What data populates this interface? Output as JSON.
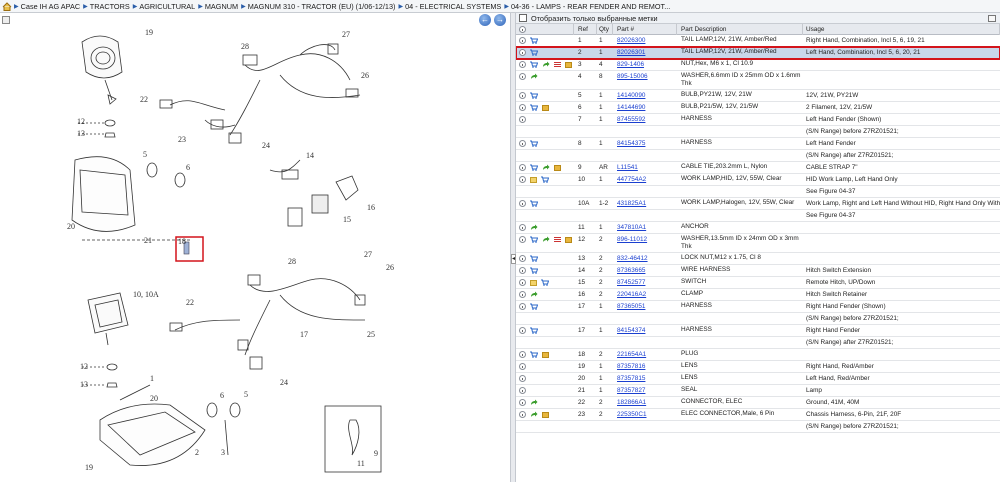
{
  "breadcrumb": [
    "Case IH AG APAC",
    "TRACTORS",
    "AGRICULTURAL",
    "MAGNUM",
    "MAGNUM 310 - TRACTOR (EU) (1/06-12/13)",
    "04 - ELECTRICAL SYSTEMS",
    "04-36 - LAMPS - REAR FENDER AND REMOT..."
  ],
  "filter_label": "Отобразить только выбранные метки",
  "columns": {
    "ref": "Ref",
    "qty": "Qty",
    "part": "Part #",
    "desc": "Part Description",
    "usage": "Usage"
  },
  "rows": [
    {
      "icons": [
        "info",
        "cart"
      ],
      "ref": "1",
      "qty": "1",
      "part": "82026300",
      "desc": "TAIL LAMP,12V, 21W, Amber/Red",
      "usage": "Right Hand, Combination, Incl 5, 6, 19, 21"
    },
    {
      "icons": [
        "info",
        "cart"
      ],
      "ref": "2",
      "qty": "1",
      "part": "82026301",
      "desc": "TAIL LAMP,12V, 21W, Amber/Red",
      "usage": "Left Hand, Combination, Incl 5, 6, 20, 21",
      "selected": true
    },
    {
      "icons": [
        "info",
        "cart",
        "arrow",
        "list",
        "box"
      ],
      "ref": "3",
      "qty": "4",
      "part": "829-1406",
      "desc": "NUT,Hex, M6 x 1, Cl 10.9",
      "usage": ""
    },
    {
      "icons": [
        "info",
        "arrow"
      ],
      "ref": "4",
      "qty": "8",
      "part": "895-15006",
      "desc": "WASHER,6.6mm ID x 25mm OD x 1.6mm Thk",
      "usage": ""
    },
    {
      "icons": [
        "info",
        "cart"
      ],
      "ref": "5",
      "qty": "1",
      "part": "14140090",
      "desc": "BULB,PY21W, 12V, 21W",
      "usage": "12V, 21W, PY21W"
    },
    {
      "icons": [
        "info",
        "cart",
        "box"
      ],
      "ref": "6",
      "qty": "1",
      "part": "14144690",
      "desc": "BULB,P21/5W, 12V, 21/5W",
      "usage": "2 Filament, 12V, 21/5W"
    },
    {
      "icons": [
        "info"
      ],
      "ref": "7",
      "qty": "1",
      "part": "87455592",
      "desc": "HARNESS",
      "usage": "Left Hand Fender (Shown)"
    },
    {
      "icons": [],
      "ref": "",
      "qty": "",
      "part": "",
      "desc": "",
      "usage": "(S/N Range) before Z7RZ01521;"
    },
    {
      "icons": [
        "info",
        "cart"
      ],
      "ref": "8",
      "qty": "1",
      "part": "84154375",
      "desc": "HARNESS",
      "usage": "Left Hand Fender"
    },
    {
      "icons": [],
      "ref": "",
      "qty": "",
      "part": "",
      "desc": "",
      "usage": "(S/N Range) after Z7RZ01521;"
    },
    {
      "icons": [
        "info",
        "cart",
        "arrow",
        "box"
      ],
      "ref": "9",
      "qty": "AR",
      "part": "L11541",
      "desc": "CABLE TIE,203.2mm L, Nylon",
      "usage": "CABLE STRAP 7\""
    },
    {
      "icons": [
        "info",
        "note",
        "cart"
      ],
      "ref": "10",
      "qty": "1",
      "part": "447754A2",
      "desc": "WORK LAMP,HID, 12V, 55W, Clear",
      "usage": "HID Work Lamp, Left Hand Only"
    },
    {
      "icons": [],
      "ref": "",
      "qty": "",
      "part": "",
      "desc": "",
      "usage": "See Figure 04-37"
    },
    {
      "icons": [
        "info",
        "cart"
      ],
      "ref": "10A",
      "qty": "1-2",
      "part": "431825A1",
      "desc": "WORK LAMP,Halogen, 12V, 55W, Clear",
      "usage": "Work Lamp, Right and Left Hand Without HID, Right Hand Only With HID"
    },
    {
      "icons": [],
      "ref": "",
      "qty": "",
      "part": "",
      "desc": "",
      "usage": "See Figure 04-37"
    },
    {
      "icons": [
        "info",
        "arrow"
      ],
      "ref": "11",
      "qty": "1",
      "part": "347810A1",
      "desc": "ANCHOR",
      "usage": ""
    },
    {
      "icons": [
        "info",
        "cart",
        "arrow",
        "list",
        "box"
      ],
      "ref": "12",
      "qty": "2",
      "part": "896-11012",
      "desc": "WASHER,13.5mm ID x 24mm OD x 3mm Thk",
      "usage": ""
    },
    {
      "icons": [
        "info",
        "cart"
      ],
      "ref": "13",
      "qty": "2",
      "part": "832-46412",
      "desc": "LOCK NUT,M12 x 1.75, Cl 8",
      "usage": ""
    },
    {
      "icons": [
        "info",
        "cart"
      ],
      "ref": "14",
      "qty": "2",
      "part": "87363665",
      "desc": "WIRE HARNESS",
      "usage": "Hitch Switch Extension"
    },
    {
      "icons": [
        "info",
        "note",
        "cart"
      ],
      "ref": "15",
      "qty": "2",
      "part": "87452577",
      "desc": "SWITCH",
      "usage": "Remote Hitch, UP/Down"
    },
    {
      "icons": [
        "info",
        "arrow"
      ],
      "ref": "16",
      "qty": "2",
      "part": "220416A2",
      "desc": "CLAMP",
      "usage": "Hitch Switch Retainer"
    },
    {
      "icons": [
        "info",
        "cart"
      ],
      "ref": "17",
      "qty": "1",
      "part": "87365051",
      "desc": "HARNESS",
      "usage": "Right Hand Fender (Shown)"
    },
    {
      "icons": [],
      "ref": "",
      "qty": "",
      "part": "",
      "desc": "",
      "usage": "(S/N Range) before Z7RZ01521;"
    },
    {
      "icons": [
        "info",
        "cart"
      ],
      "ref": "17",
      "qty": "1",
      "part": "84154374",
      "desc": "HARNESS",
      "usage": "Right Hand Fender"
    },
    {
      "icons": [],
      "ref": "",
      "qty": "",
      "part": "",
      "desc": "",
      "usage": "(S/N Range) after Z7RZ01521;"
    },
    {
      "icons": [
        "info",
        "cart",
        "box"
      ],
      "ref": "18",
      "qty": "2",
      "part": "221654A1",
      "desc": "PLUG",
      "usage": ""
    },
    {
      "icons": [
        "info"
      ],
      "ref": "19",
      "qty": "1",
      "part": "87357816",
      "desc": "LENS",
      "usage": "Right Hand, Red/Amber"
    },
    {
      "icons": [
        "info"
      ],
      "ref": "20",
      "qty": "1",
      "part": "87357815",
      "desc": "LENS",
      "usage": "Left Hand, Red/Amber"
    },
    {
      "icons": [
        "info"
      ],
      "ref": "21",
      "qty": "1",
      "part": "87357827",
      "desc": "SEAL",
      "usage": "Lamp"
    },
    {
      "icons": [
        "info",
        "arrow"
      ],
      "ref": "22",
      "qty": "2",
      "part": "182866A1",
      "desc": "CONNECTOR, ELEC",
      "usage": "Ground, 41M, 40M"
    },
    {
      "icons": [
        "info",
        "arrow",
        "box"
      ],
      "ref": "23",
      "qty": "2",
      "part": "225350C1",
      "desc": "ELEC CONNECTOR,Male, 6 Pin",
      "usage": "Chassis Harness, 6-Pin, 21F, 20F"
    },
    {
      "icons": [],
      "ref": "",
      "qty": "",
      "part": "",
      "desc": "",
      "usage": "(S/N Range) before Z7RZ01521;"
    }
  ],
  "diagram_labels": [
    "19",
    "28",
    "27",
    "26",
    "22",
    "12",
    "13",
    "23",
    "24",
    "6",
    "5",
    "20",
    "21",
    "18",
    "14",
    "15",
    "16",
    "28",
    "27",
    "26",
    "10, 10A",
    "22",
    "25",
    "17",
    "12",
    "13",
    "24",
    "1",
    "20",
    "6",
    "5",
    "19",
    "2",
    "3",
    "9",
    "11"
  ]
}
